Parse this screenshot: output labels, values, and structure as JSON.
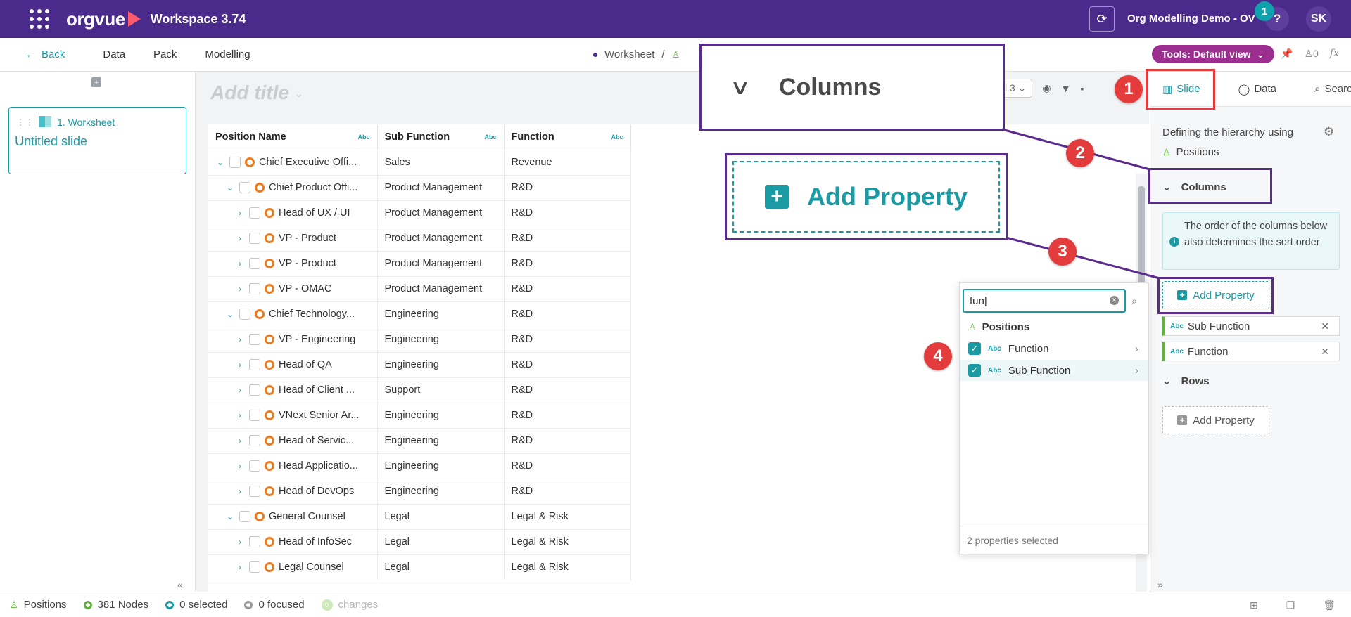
{
  "app": {
    "brand": "orgvue",
    "title": "Workspace 3.74",
    "org": "Org Modelling Demo - OV",
    "help": "?",
    "notifications": "1",
    "user_initials": "SK"
  },
  "subnav": {
    "back": "Back",
    "items": [
      "Data",
      "Pack",
      "Modelling"
    ],
    "crumb_worksheet": "Worksheet",
    "crumb_sep": "/",
    "tools": "Tools: Default view",
    "counter": "0",
    "fx": "fx"
  },
  "slides": {
    "items": [
      {
        "number": "1. Worksheet",
        "title": "Untitled slide"
      }
    ]
  },
  "canvas": {
    "add_title": "Add title",
    "pager": "l 3"
  },
  "table": {
    "columns": [
      "Position Name",
      "Sub Function",
      "Function"
    ],
    "abc": "Abc",
    "rows": [
      {
        "level": 0,
        "expander": "v",
        "name": "Chief Executive Offi...",
        "sub": "Sales",
        "func": "Revenue"
      },
      {
        "level": 1,
        "expander": "v",
        "name": "Chief Product Offi...",
        "sub": "Product Management",
        "func": "R&D"
      },
      {
        "level": 2,
        "expander": ">",
        "name": "Head of UX / UI",
        "sub": "Product Management",
        "func": "R&D"
      },
      {
        "level": 2,
        "expander": ">",
        "name": "VP - Product",
        "sub": "Product Management",
        "func": "R&D"
      },
      {
        "level": 2,
        "expander": ">",
        "name": "VP - Product",
        "sub": "Product Management",
        "func": "R&D"
      },
      {
        "level": 2,
        "expander": ">",
        "name": "VP - OMAC",
        "sub": "Product Management",
        "func": "R&D"
      },
      {
        "level": 1,
        "expander": "v",
        "name": "Chief Technology...",
        "sub": "Engineering",
        "func": "R&D"
      },
      {
        "level": 2,
        "expander": ">",
        "name": "VP - Engineering",
        "sub": "Engineering",
        "func": "R&D"
      },
      {
        "level": 2,
        "expander": ">",
        "name": "Head of QA",
        "sub": "Engineering",
        "func": "R&D"
      },
      {
        "level": 2,
        "expander": ">",
        "name": "Head of Client ...",
        "sub": "Support",
        "func": "R&D"
      },
      {
        "level": 2,
        "expander": ">",
        "name": "VNext Senior Ar...",
        "sub": "Engineering",
        "func": "R&D"
      },
      {
        "level": 2,
        "expander": ">",
        "name": "Head of Servic...",
        "sub": "Engineering",
        "func": "R&D"
      },
      {
        "level": 2,
        "expander": ">",
        "name": "Head Applicatio...",
        "sub": "Engineering",
        "func": "R&D"
      },
      {
        "level": 2,
        "expander": ">",
        "name": "Head of DevOps",
        "sub": "Engineering",
        "func": "R&D"
      },
      {
        "level": 1,
        "expander": "v",
        "name": "General Counsel",
        "sub": "Legal",
        "func": "Legal & Risk"
      },
      {
        "level": 2,
        "expander": ">",
        "name": "Head of InfoSec",
        "sub": "Legal",
        "func": "Legal & Risk"
      },
      {
        "level": 2,
        "expander": ">",
        "name": "Legal Counsel",
        "sub": "Legal",
        "func": "Legal & Risk"
      }
    ]
  },
  "rightpanel": {
    "tabs": [
      "Slide",
      "Data",
      "Search"
    ],
    "hierarchy_label": "Defining the hierarchy using",
    "hierarchy_value": "Positions",
    "columns_heading": "Columns",
    "info_text": "The order of the columns below also determines the sort order",
    "add_property": "Add Property",
    "column_chips": [
      "Sub Function",
      "Function"
    ],
    "rows_heading": "Rows"
  },
  "popover": {
    "search_value": "fun",
    "group": "Positions",
    "items": [
      "Function",
      "Sub Function"
    ],
    "footer": "2 properties selected"
  },
  "callouts": {
    "columns": "Columns",
    "add_property": "Add Property",
    "steps": [
      "1",
      "2",
      "3",
      "4"
    ]
  },
  "status": {
    "dimension": "Positions",
    "nodes": "381 Nodes",
    "selected": "0 selected",
    "focused": "0 focused",
    "changes": "changes",
    "changes_count": "0"
  }
}
